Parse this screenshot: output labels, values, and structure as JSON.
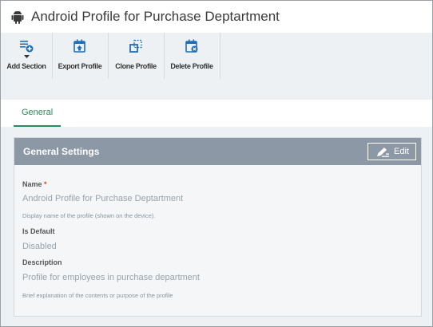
{
  "header": {
    "title": "Android Profile for Purchase Deptartment",
    "icon": "android-icon"
  },
  "toolbar": {
    "add_section": "Add Section",
    "export_profile": "Export Profile",
    "clone_profile": "Clone Profile",
    "delete_profile": "Delete Profile"
  },
  "tabs": [
    {
      "label": "General",
      "active": true
    }
  ],
  "panel": {
    "title": "General Settings",
    "edit_label": "Edit",
    "fields": {
      "name_label": "Name",
      "name_required": "*",
      "name_value": "Android Profile for Purchase Deptartment",
      "name_help": "Display name of the profile (shown on the device).",
      "default_label": "Is Default",
      "default_value": "Disabled",
      "description_label": "Description",
      "description_value": "Profile for employees in purchase department",
      "description_help": "Brief explanation of the contents or purpose of the profile"
    }
  },
  "colors": {
    "accent": "#2b8a5e",
    "icon_blue": "#1e6fb8",
    "panel_header": "#8c98a6"
  }
}
